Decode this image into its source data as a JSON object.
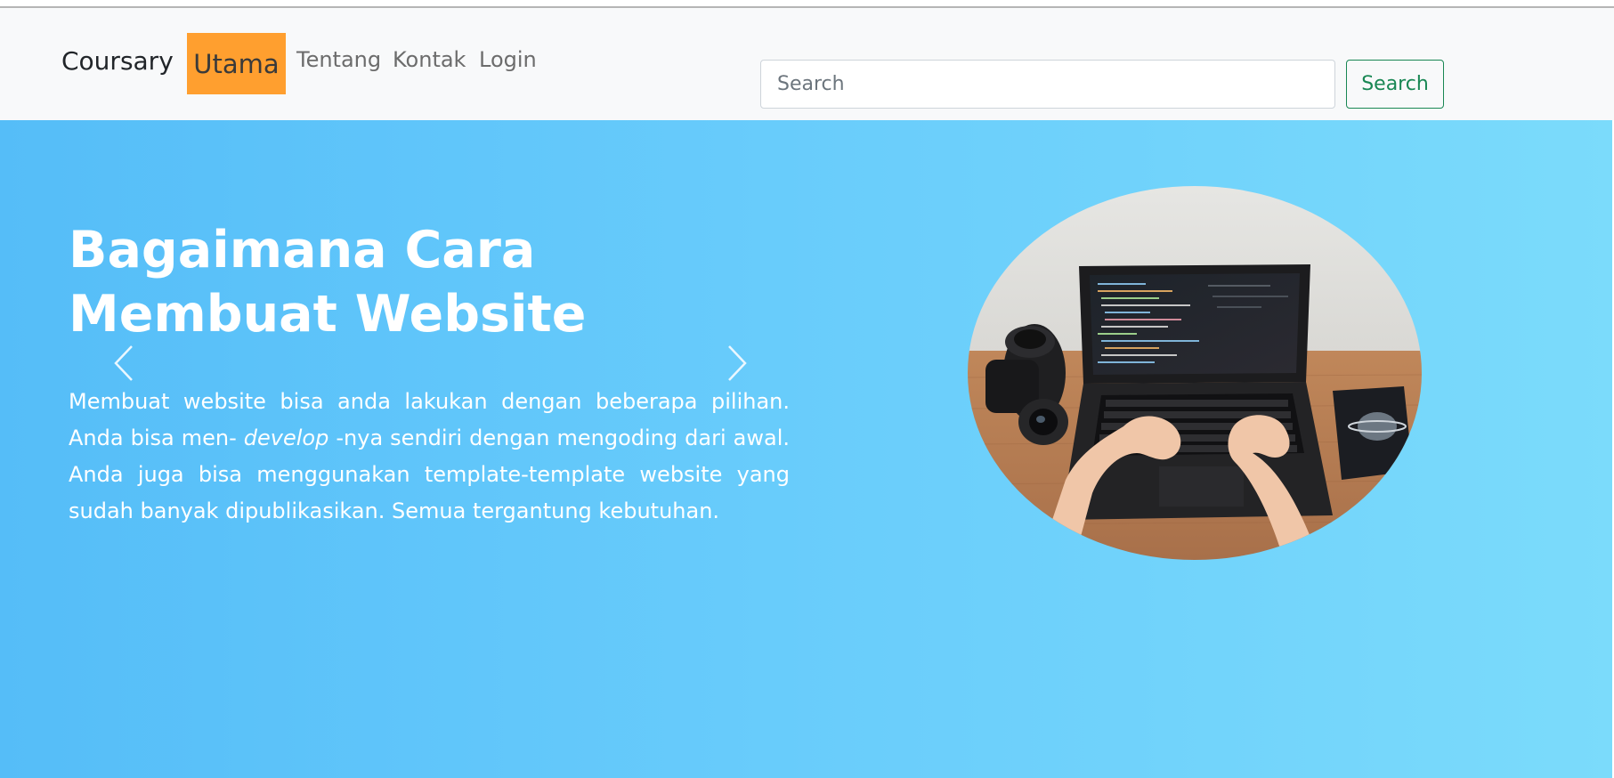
{
  "navbar": {
    "brand": "Coursary",
    "items": [
      {
        "label": "Utama",
        "active": true
      },
      {
        "label": "Tentang"
      },
      {
        "label": "Kontak"
      },
      {
        "label": "Login"
      }
    ],
    "search": {
      "placeholder": "Search",
      "value": "",
      "button_label": "Search"
    }
  },
  "hero": {
    "title": "Bagaimana Cara Membuat Website",
    "text_before": "Membuat website bisa anda lakukan dengan beberapa pilihan. Anda bisa men- ",
    "text_em": "develop",
    "text_after": " -nya sendiri dengan mengoding dari awal. Anda juga bisa menggunakan template-template website yang sudah banyak dipublikasikan. Semua tergantung kebutuhan.",
    "prev_icon": "chevron-left-icon",
    "next_icon": "chevron-right-icon",
    "image": "laptop-coding-photo"
  },
  "colors": {
    "active_nav": "#ff9f2f",
    "navbar_bg": "#f8f9fa",
    "search_button": "#198754",
    "hero_gradient_start": "#55bdf8",
    "hero_gradient_end": "#7bdbfb"
  }
}
